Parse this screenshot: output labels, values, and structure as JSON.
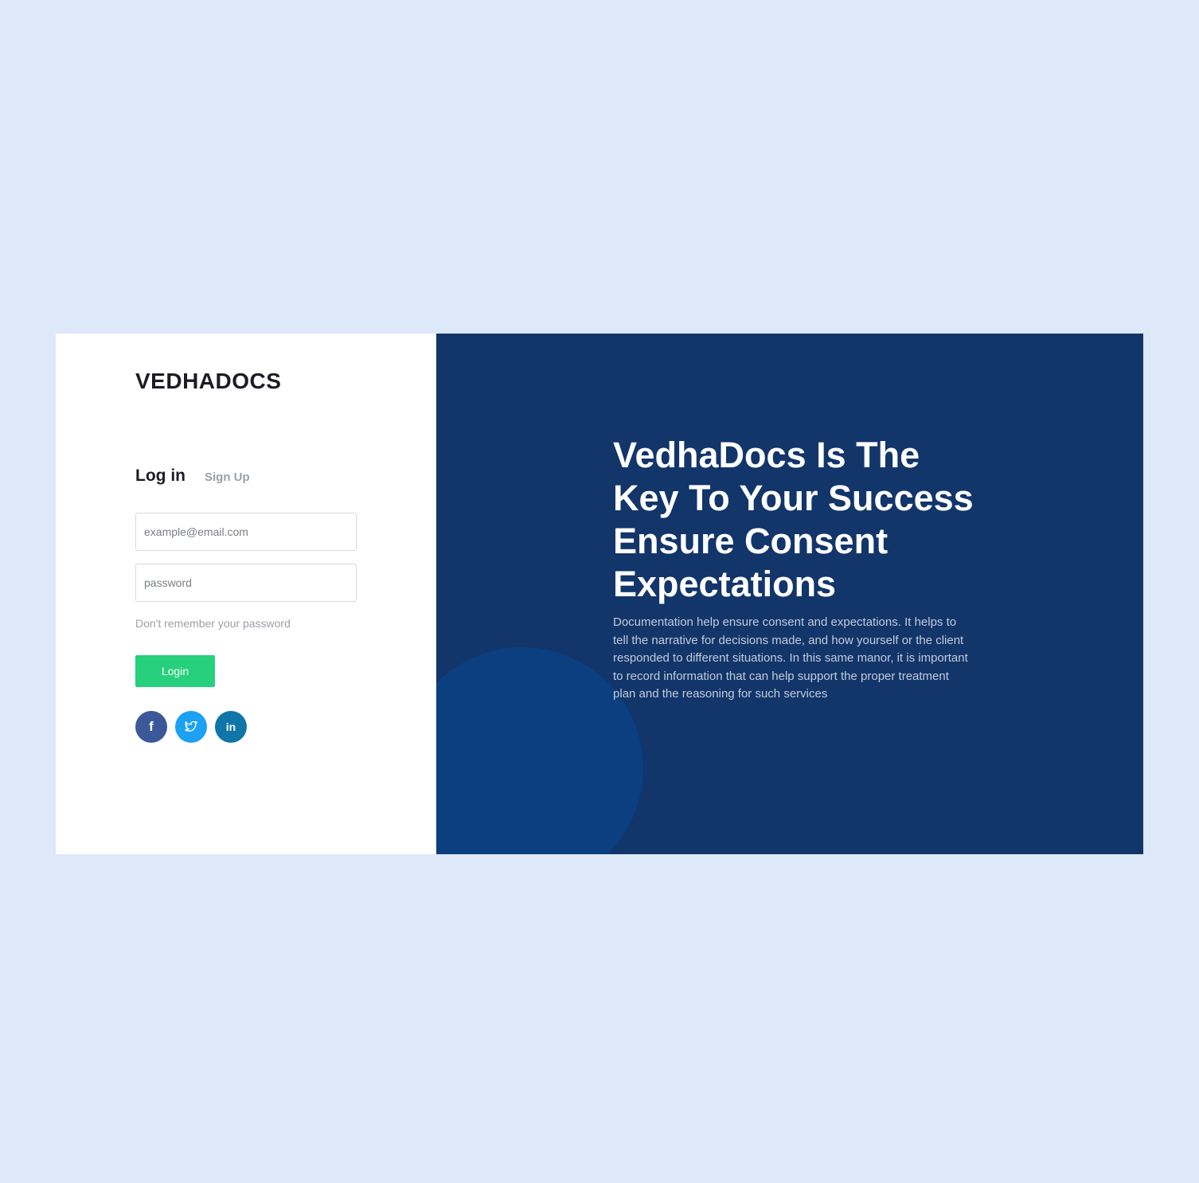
{
  "brand": {
    "name": "VEDHADOCS"
  },
  "auth": {
    "tab_login": "Log in",
    "tab_signup": "Sign Up",
    "email_placeholder": "example@email.com",
    "password_placeholder": "password",
    "forgot_link": "Don't remember your password",
    "login_button": "Login"
  },
  "socials": [
    {
      "name": "facebook",
      "glyph": "f",
      "color": "#3b5998"
    },
    {
      "name": "twitter",
      "glyph": "t",
      "color": "#1da1f2"
    },
    {
      "name": "linkedin",
      "glyph": "in",
      "color": "#0e76a8"
    }
  ],
  "hero": {
    "title_line1": "VedhaDocs Is The Key To Your Success",
    "title_line2": "Ensure Consent Expectations",
    "description": "Documentation help ensure consent and expectations. It helps to tell the narrative for decisions made, and how yourself or the client responded to different situations. In this same manor, it is important to record information that can help support the proper treatment plan and the reasoning for such services"
  },
  "colors": {
    "page_bg": "#dde8f8",
    "panel_bg": "#12356a",
    "accent_green": "#26d07c"
  }
}
